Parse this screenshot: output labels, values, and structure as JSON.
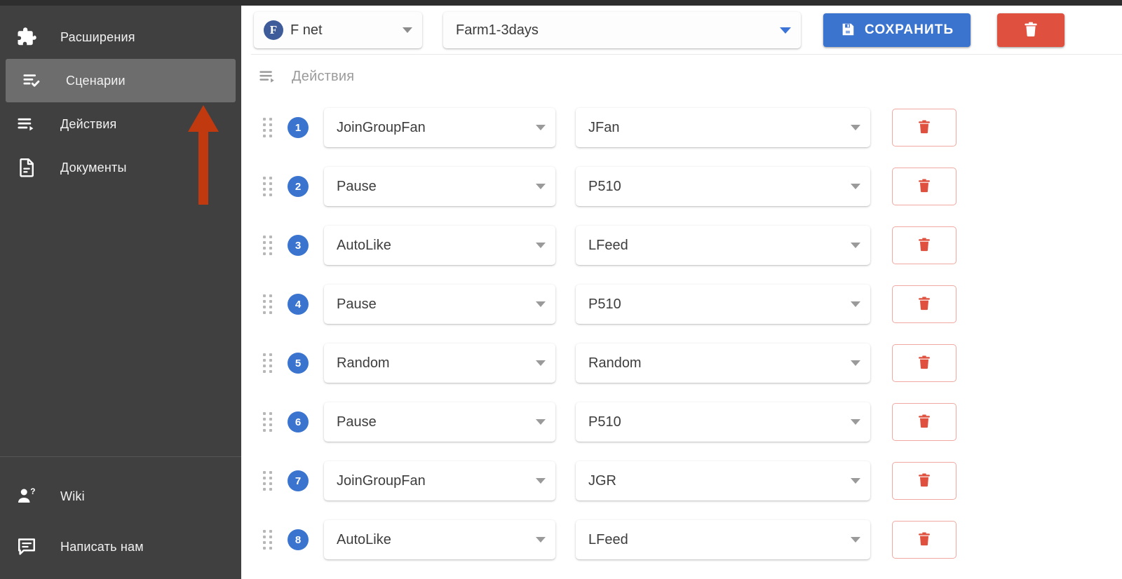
{
  "sidebar": {
    "main_items": [
      {
        "label": "Расширения",
        "icon": "puzzle-icon",
        "active": false
      },
      {
        "label": "Сценарии",
        "icon": "list-check-icon",
        "active": true
      },
      {
        "label": "Действия",
        "icon": "list-play-icon",
        "active": false
      },
      {
        "label": "Документы",
        "icon": "document-icon",
        "active": false
      }
    ],
    "bottom_items": [
      {
        "label": "Wiki",
        "icon": "person-question-icon"
      },
      {
        "label": "Написать нам",
        "icon": "chat-bubble-icon"
      }
    ]
  },
  "annotation": {
    "type": "arrow-up",
    "color": "#C0390F",
    "points_to": "Сценарии"
  },
  "toolbar": {
    "network_select": {
      "badge_letter": "F",
      "badge_color": "#3f5c9a",
      "value": "F net"
    },
    "scenario_select": {
      "value": "Farm1-3days"
    },
    "save_button": {
      "label": "СОХРАНИТЬ",
      "icon": "save-floppy-icon",
      "color": "#3b74cf"
    },
    "delete_button": {
      "icon": "trash-icon",
      "color": "#e0503f"
    }
  },
  "section": {
    "title": "Действия",
    "icon": "list-play-icon"
  },
  "rows": [
    {
      "index": "1",
      "action": "JoinGroupFan",
      "param": "JFan"
    },
    {
      "index": "2",
      "action": "Pause",
      "param": "P510"
    },
    {
      "index": "3",
      "action": "AutoLike",
      "param": "LFeed"
    },
    {
      "index": "4",
      "action": "Pause",
      "param": "P510"
    },
    {
      "index": "5",
      "action": "Random",
      "param": "Random"
    },
    {
      "index": "6",
      "action": "Pause",
      "param": "P510"
    },
    {
      "index": "7",
      "action": "JoinGroupFan",
      "param": "JGR"
    },
    {
      "index": "8",
      "action": "AutoLike",
      "param": "LFeed"
    }
  ],
  "colors": {
    "sidebar_bg": "#404040",
    "sidebar_active_bg": "#6d6d6d",
    "accent_blue": "#3b74cf",
    "danger_red": "#e0503f",
    "danger_border": "#f0a9a1"
  }
}
